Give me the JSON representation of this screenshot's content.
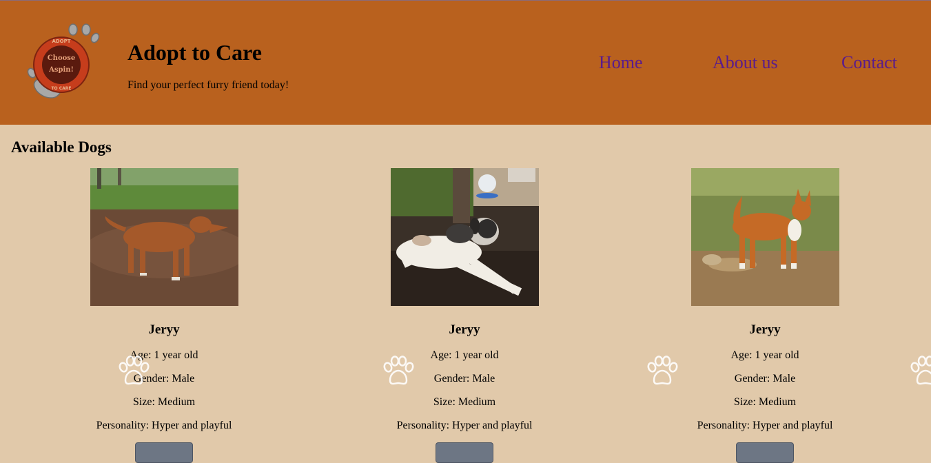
{
  "header": {
    "logo_text": {
      "top": "ADOPT",
      "middle_1": "Choose",
      "middle_2": "Aspin!",
      "bottom": "TO CARE"
    },
    "title": "Adopt to Care",
    "tagline": "Find your perfect furry friend today!",
    "nav": [
      {
        "label": "Home"
      },
      {
        "label": "About us"
      },
      {
        "label": "Contact"
      }
    ]
  },
  "main": {
    "section_title": "Available Dogs",
    "dogs": [
      {
        "name": "Jeryy",
        "age": "Age: 1 year old",
        "gender": "Gender: Male",
        "size": "Size: Medium",
        "personality": "Personality: Hyper and playful"
      },
      {
        "name": "Jeryy",
        "age": "Age: 1 year old",
        "gender": "Gender: Male",
        "size": "Size: Medium",
        "personality": "Personality: Hyper and playful"
      },
      {
        "name": "Jeryy",
        "age": "Age: 1 year old",
        "gender": "Gender: Male",
        "size": "Size: Medium",
        "personality": "Personality: Hyper and playful"
      }
    ]
  },
  "colors": {
    "header_bg": "#b9611e",
    "page_bg": "#e1c9aa",
    "nav_link": "#5a1c8c",
    "button": "#6d7684"
  },
  "icons": [
    "paw-logo-icon",
    "paw-print-icon"
  ]
}
